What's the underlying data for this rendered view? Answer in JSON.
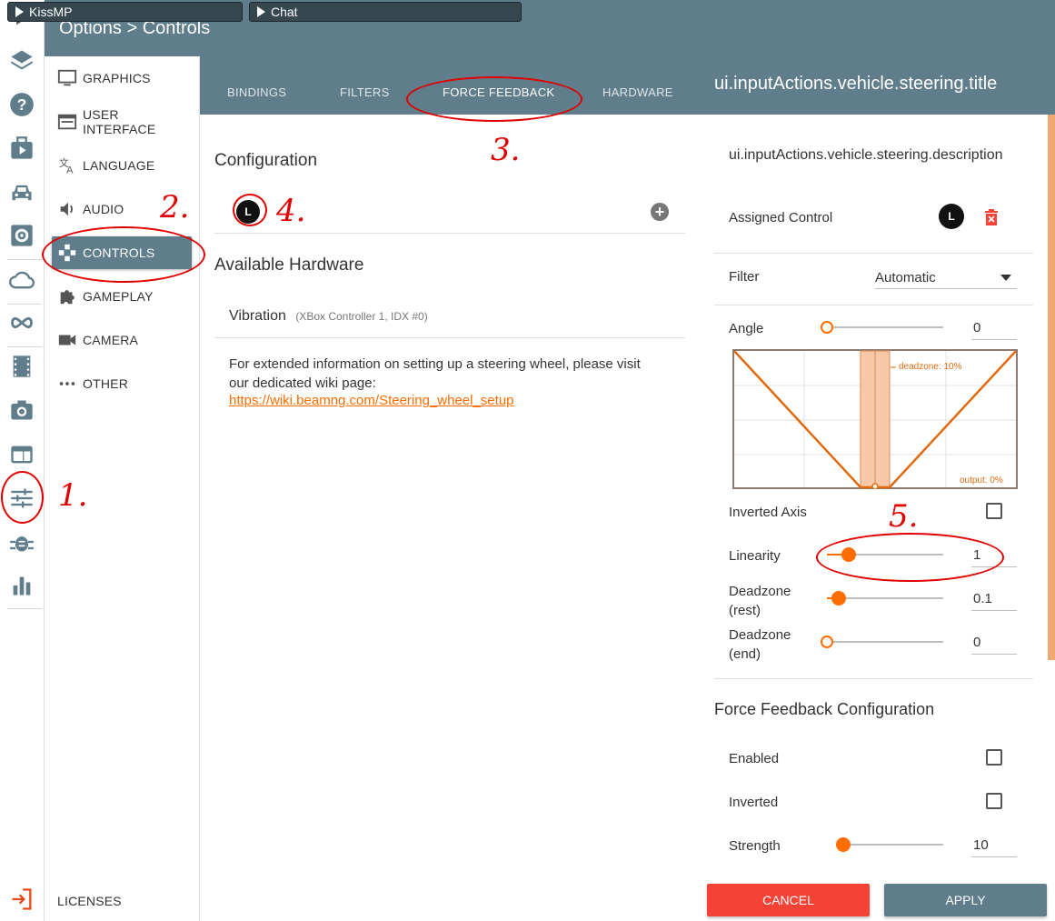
{
  "overlay": {
    "kissmp_label": "KissMP",
    "chat_label": "Chat"
  },
  "header": {
    "breadcrumb": "Options  >  Controls"
  },
  "menu": {
    "items": [
      {
        "label": "GRAPHICS",
        "icon": "monitor-icon"
      },
      {
        "label": "USER INTERFACE",
        "icon": "window-icon"
      },
      {
        "label": "LANGUAGE",
        "icon": "translate-icon"
      },
      {
        "label": "AUDIO",
        "icon": "speaker-icon"
      },
      {
        "label": "CONTROLS",
        "icon": "gamepad-icon",
        "active": true
      },
      {
        "label": "GAMEPLAY",
        "icon": "puzzle-icon"
      },
      {
        "label": "CAMERA",
        "icon": "videocam-icon"
      },
      {
        "label": "OTHER",
        "icon": "more-dots-icon"
      }
    ],
    "licenses_label": "LICENSES"
  },
  "tabs": {
    "items": [
      "BINDINGS",
      "FILTERS",
      "FORCE FEEDBACK",
      "HARDWARE"
    ],
    "active": "FORCE FEEDBACK"
  },
  "right_title": "ui.inputActions.vehicle.steering.title",
  "middle": {
    "configuration_title": "Configuration",
    "config_badge": "L",
    "available_hardware_title": "Available Hardware",
    "device_name": "Vibration",
    "device_detail": "(XBox Controller 1, IDX #0)",
    "info_text": "For extended information on setting up a steering wheel, please visit our dedicated wiki page:",
    "wiki_link": "https://wiki.beamng.com/Steering_wheel_setup"
  },
  "right": {
    "description": "ui.inputActions.vehicle.steering.description",
    "assigned_control_label": "Assigned Control",
    "assigned_badge": "L",
    "filter_label": "Filter",
    "filter_value": "Automatic",
    "angle_label": "Angle",
    "angle_value": "0",
    "graph_deadzone_label": "deadzone: 10%",
    "graph_output_label": "output: 0%",
    "inverted_axis_label": "Inverted Axis",
    "inverted_axis_checked": false,
    "linearity_label": "Linearity",
    "linearity_value": "1",
    "deadzone_rest_label_1": "Deadzone",
    "deadzone_rest_label_2": "(rest)",
    "deadzone_rest_value": "0.1",
    "deadzone_end_label_1": "Deadzone",
    "deadzone_end_label_2": "(end)",
    "deadzone_end_value": "0",
    "ffb_title": "Force Feedback Configuration",
    "enabled_label": "Enabled",
    "enabled_checked": false,
    "inverted_label": "Inverted",
    "inverted_checked": false,
    "strength_label": "Strength",
    "strength_value": "10"
  },
  "buttons": {
    "cancel": "CANCEL",
    "apply": "APPLY"
  },
  "annotations": {
    "n1": "1.",
    "n2": "2.",
    "n3": "3.",
    "n4": "4.",
    "n5": "5."
  },
  "colors": {
    "header": "#607d8b",
    "accent": "#ff6d00",
    "cancel": "#f44336",
    "apply": "#607d8b"
  }
}
